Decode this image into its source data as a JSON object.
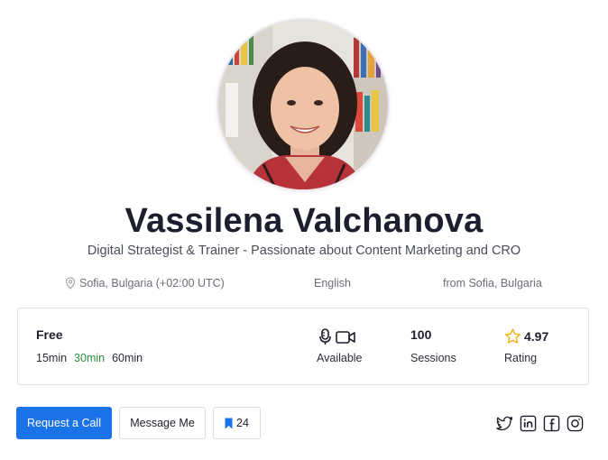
{
  "profile": {
    "name": "Vassilena Valchanova",
    "headline": "Digital Strategist & Trainer - Passionate about Content Marketing and CRO",
    "location": "Sofia, Bulgaria (+02:00 UTC)",
    "language": "English",
    "from": "from Sofia, Bulgaria"
  },
  "stats": {
    "price": "Free",
    "durations": [
      "15min",
      "30min",
      "60min"
    ],
    "selected_duration": "30min",
    "availability_label": "Available",
    "sessions_value": "100",
    "sessions_label": "Sessions",
    "rating_value": "4.97",
    "rating_label": "Rating"
  },
  "actions": {
    "request_call": "Request a Call",
    "message": "Message Me",
    "bookmark_count": "24"
  },
  "socials": [
    "twitter-icon",
    "linkedin-icon",
    "facebook-icon",
    "instagram-icon"
  ],
  "colors": {
    "primary": "#1a73e8",
    "active_duration": "#2e8b3e",
    "star": "#f2b01e"
  }
}
